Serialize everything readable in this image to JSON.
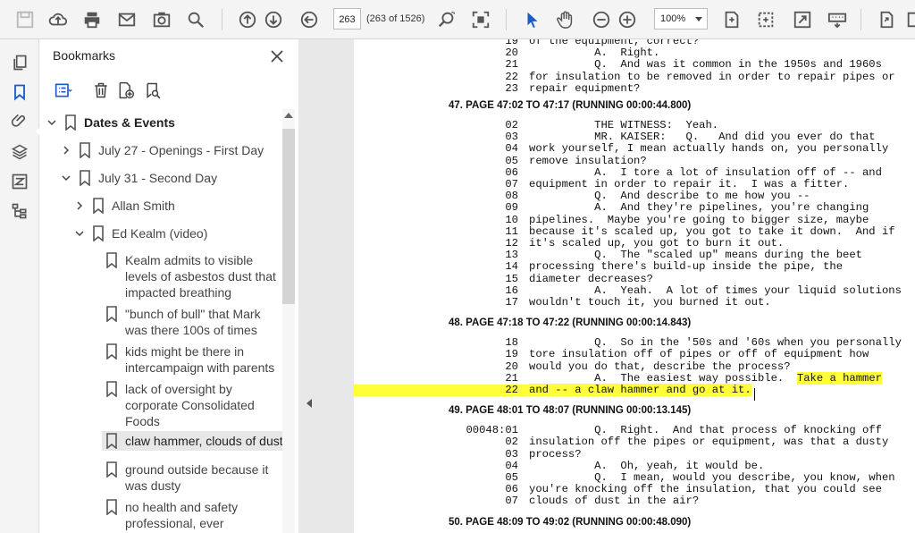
{
  "toolbar": {
    "page_value": "263",
    "page_count": "(263 of 1526)",
    "zoom": "100%"
  },
  "bookmarks_panel": {
    "title": "Bookmarks",
    "items": [
      {
        "label": "Dates & Events"
      },
      {
        "label": "July 27 - Openings - First Day"
      },
      {
        "label": "July 31 - Second Day"
      },
      {
        "label": "Allan Smith"
      },
      {
        "label": "Ed Kealm (video)"
      },
      {
        "label_lines": [
          "Kealm admits to visible",
          "levels of asbestos dust that",
          "impacted breathing"
        ]
      },
      {
        "label_lines": [
          "\"bunch of bull\" that Mark",
          "was there 100s of times"
        ]
      },
      {
        "label_lines": [
          "kids might be there in",
          "intercampaign with parents"
        ]
      },
      {
        "label_lines": [
          "lack of oversight by",
          "corporate Consolidated",
          "Foods"
        ]
      },
      {
        "label": "claw hammer, clouds of dust"
      },
      {
        "label_lines": [
          "ground outside because it",
          "was dusty"
        ]
      },
      {
        "label_lines": [
          "no health and safety",
          "professional, ever"
        ]
      }
    ]
  },
  "document": {
    "top_lines": [
      {
        "num": "19",
        "text": "of the equipment, correct?"
      },
      {
        "num": "20",
        "text": "          A.  Right."
      },
      {
        "num": "21",
        "text": "          Q.  And was it common in the 1950s and 1960s"
      },
      {
        "num": "22",
        "text": "for insulation to be removed in order to repair pipes or"
      },
      {
        "num": "23",
        "text": "repair equipment?"
      }
    ],
    "sections": [
      {
        "heading": "47. PAGE 47:02 TO 47:17  (RUNNING 00:00:44.800)",
        "lines": [
          {
            "num": "02",
            "text": "          THE WITNESS:  Yeah."
          },
          {
            "num": "03",
            "text": "          MR. KAISER:   Q.   And did you ever do that"
          },
          {
            "num": "04",
            "text": "work yourself, I mean actually hands on, you personally"
          },
          {
            "num": "05",
            "text": "remove insulation?"
          },
          {
            "num": "06",
            "text": "          A.  I tore a lot of insulation off of -- and"
          },
          {
            "num": "07",
            "text": "equipment in order to repair it.  I was a fitter."
          },
          {
            "num": "08",
            "text": "          Q.  And describe to me how you --"
          },
          {
            "num": "09",
            "text": "          A.  And they're pipelines, you're changing"
          },
          {
            "num": "10",
            "text": "pipelines.  Maybe you're going to bigger size, maybe"
          },
          {
            "num": "11",
            "text": "because it's scaled up, you got to take it down.  And if"
          },
          {
            "num": "12",
            "text": "it's scaled up, you got to burn it out."
          },
          {
            "num": "13",
            "text": "          Q.  The \"scaled up\" means during the beet"
          },
          {
            "num": "14",
            "text": "processing there's build-up inside the pipe, the"
          },
          {
            "num": "15",
            "text": "diameter decreases?"
          },
          {
            "num": "16",
            "text": "          A.  Yeah.  A lot of times your liquid solutions"
          },
          {
            "num": "17",
            "text": "wouldn't touch it, you burned it out."
          }
        ]
      },
      {
        "heading": "48. PAGE 47:18 TO 47:22  (RUNNING 00:00:14.843)",
        "lines": [
          {
            "num": "18",
            "text": "          Q.  So in the '50s and '60s when you personally"
          },
          {
            "num": "19",
            "text": "tore insulation off of pipes or off of equipment how"
          },
          {
            "num": "20",
            "text": "would you do that, describe the process?"
          },
          {
            "num": "21",
            "text": "          A.  The easiest way possible.  ",
            "hl_text": "Take a hammer"
          },
          {
            "num": "22",
            "text": "",
            "hl_text": "and -- a claw hammer and go at it.",
            "num_hl": true
          }
        ]
      },
      {
        "heading": "49. PAGE 48:01 TO 48:07  (RUNNING 00:00:13.145)",
        "lines": [
          {
            "num": "00048:01",
            "text": "          Q.  Right.  And that process of knocking off"
          },
          {
            "num": "02",
            "text": "insulation off the pipes or equipment, was that a dusty"
          },
          {
            "num": "03",
            "text": "process?"
          },
          {
            "num": "04",
            "text": "          A.  Oh, yeah, it would be."
          },
          {
            "num": "05",
            "text": "          Q.  I mean, would you describe, you know, when"
          },
          {
            "num": "06",
            "text": "you're knocking off the insulation, that you could see"
          },
          {
            "num": "07",
            "text": "clouds of dust in the air?"
          }
        ]
      },
      {
        "heading": "50. PAGE 48:09 TO 49:02  (RUNNING 00:00:48.090)",
        "lines": []
      }
    ]
  }
}
